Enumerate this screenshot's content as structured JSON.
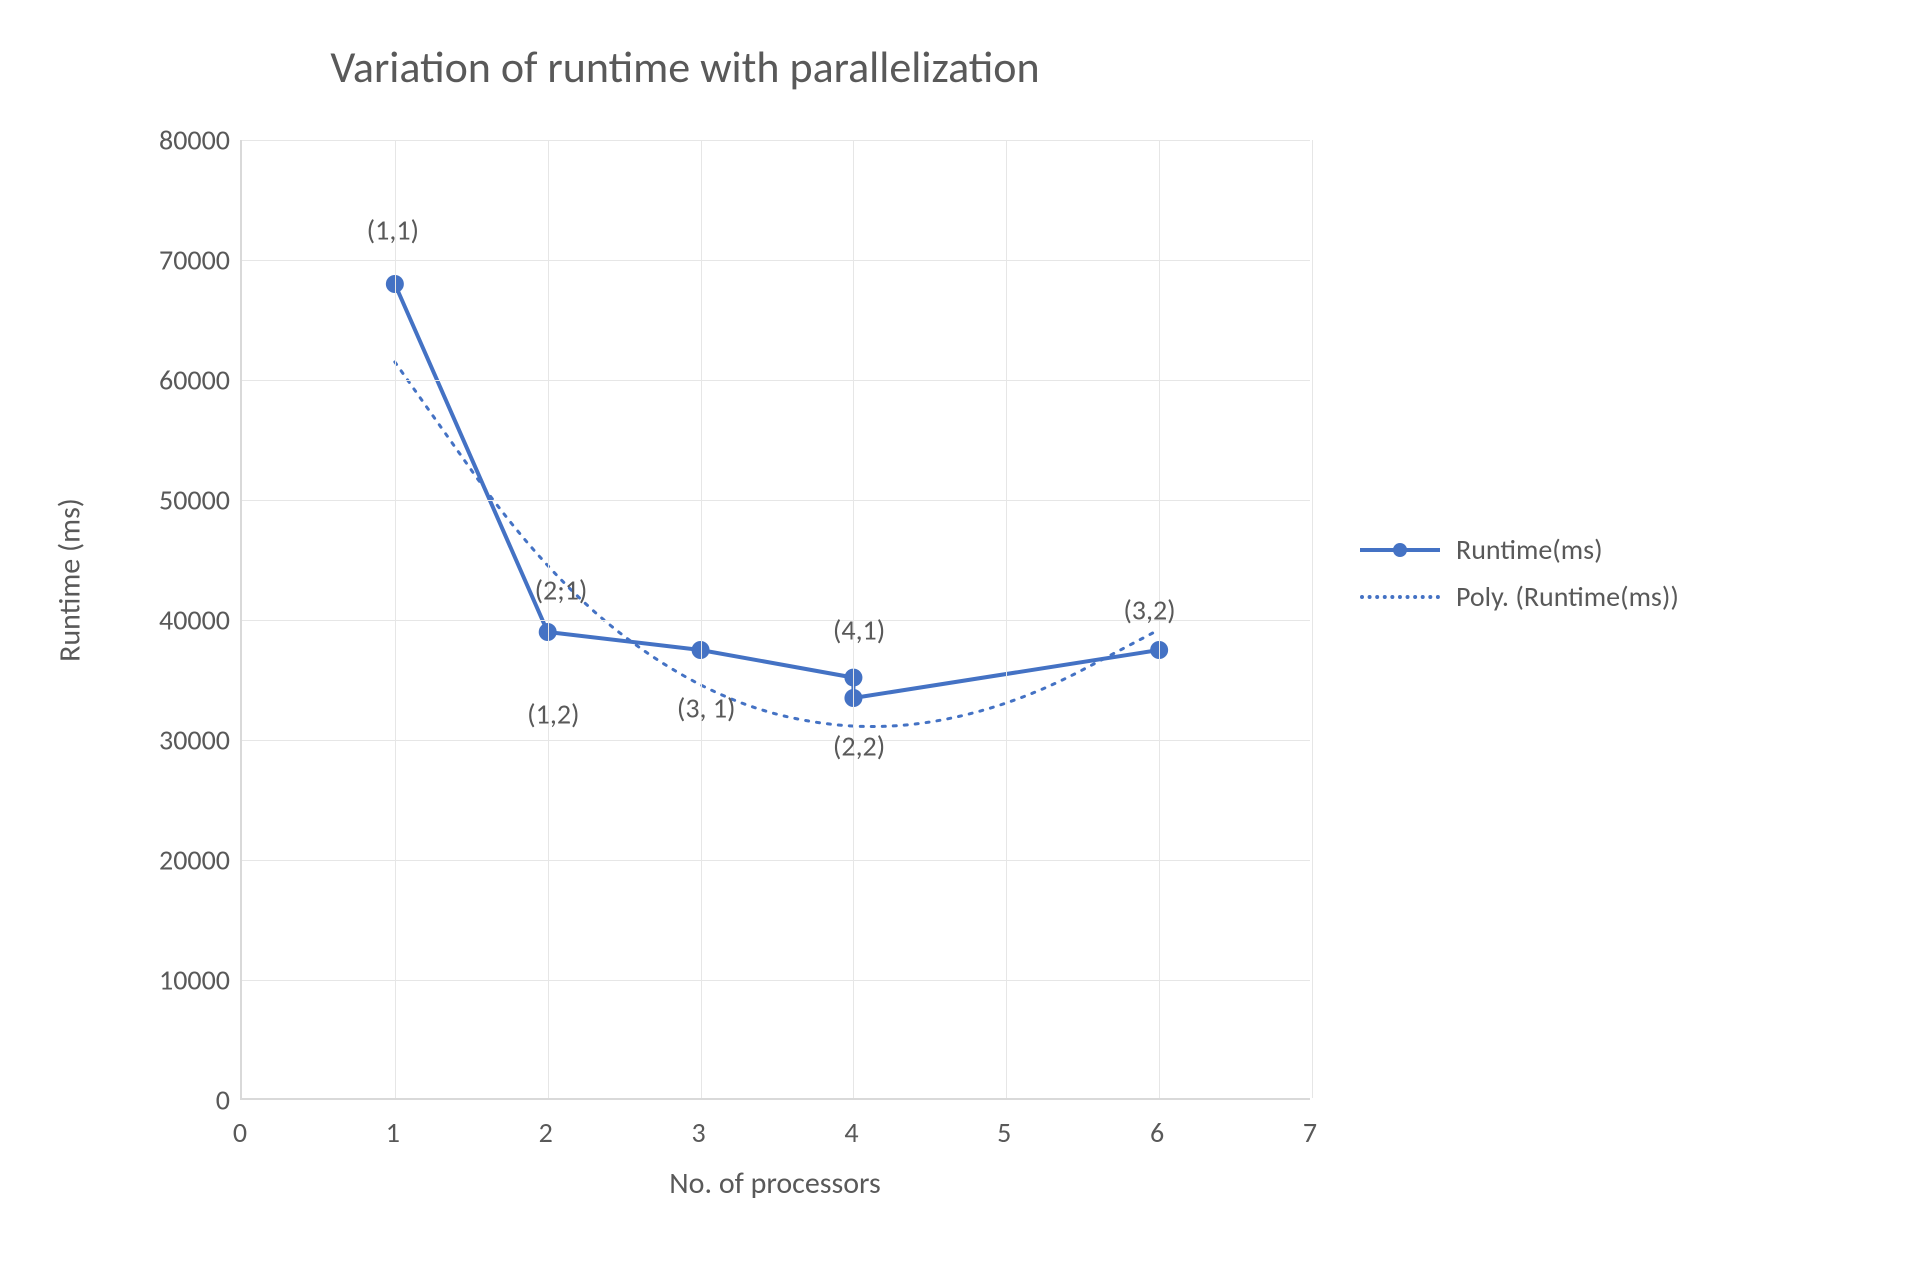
{
  "chart_data": {
    "type": "line",
    "title": "Variation of runtime with parallelization",
    "xlabel": "No. of processors",
    "ylabel": "Runtime (ms)",
    "xlim": [
      0,
      7
    ],
    "ylim": [
      0,
      80000
    ],
    "xticks": [
      0,
      1,
      2,
      3,
      4,
      5,
      6,
      7
    ],
    "yticks": [
      0,
      10000,
      20000,
      30000,
      40000,
      50000,
      60000,
      70000,
      80000
    ],
    "series": [
      {
        "name": "Runtime(ms)",
        "style": "solid-markers",
        "color": "#4472c4",
        "points": [
          {
            "x": 1,
            "y": 68000
          },
          {
            "x": 2,
            "y": 39000
          },
          {
            "x": 3,
            "y": 37500
          },
          {
            "x": 4,
            "y": 35200
          },
          {
            "x": 4,
            "y": 33500
          },
          {
            "x": 6,
            "y": 37500
          }
        ]
      },
      {
        "name": "Poly. (Runtime(ms))",
        "style": "dotted",
        "color": "#4472c4",
        "points": [
          {
            "x": 1,
            "y": 61500
          },
          {
            "x": 2,
            "y": 43500
          },
          {
            "x": 3,
            "y": 33800
          },
          {
            "x": 4,
            "y": 30500
          },
          {
            "x": 5,
            "y": 32500
          },
          {
            "x": 6,
            "y": 39200
          }
        ]
      }
    ],
    "annotations": [
      {
        "text": "(1,1)",
        "x": 1.0,
        "y": 72500
      },
      {
        "text": "(2;1)",
        "x": 2.1,
        "y": 42500
      },
      {
        "text": "(1,2)",
        "x": 2.05,
        "y": 32200
      },
      {
        "text": "(3, 1)",
        "x": 3.05,
        "y": 32700
      },
      {
        "text": "(4,1)",
        "x": 4.05,
        "y": 39200
      },
      {
        "text": "(2,2)",
        "x": 4.05,
        "y": 29500
      },
      {
        "text": "(3,2)",
        "x": 5.95,
        "y": 40800
      }
    ]
  },
  "legend": {
    "items": [
      {
        "label": "Runtime(ms)"
      },
      {
        "label": "Poly. (Runtime(ms))"
      }
    ]
  }
}
